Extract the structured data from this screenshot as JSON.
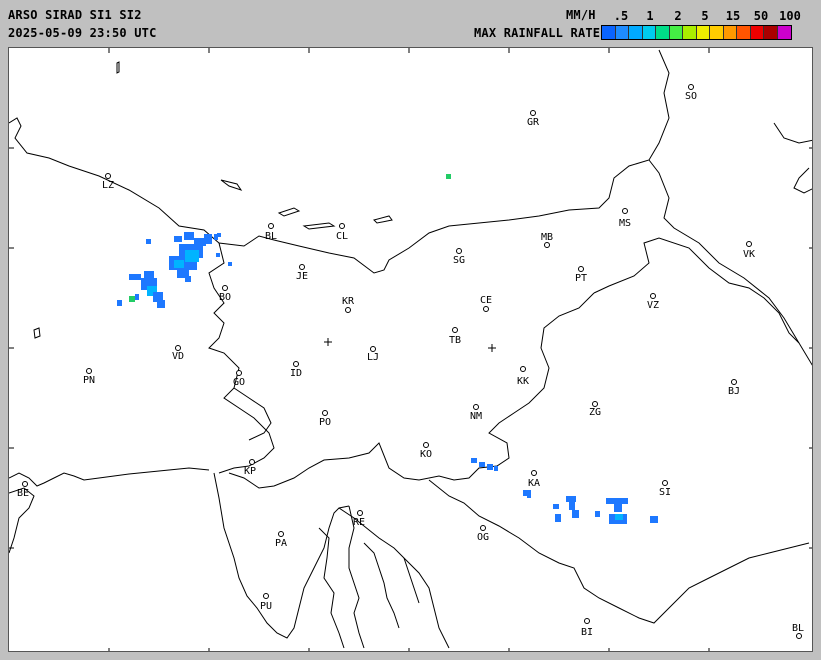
{
  "header": {
    "title": "ARSO SIRAD SI1 SI2",
    "timestamp": "2025-05-09 23:50 UTC",
    "unit": "MM/H",
    "legend_label": "MAX RAINFALL RATE"
  },
  "legend": {
    "ticks": [
      ".5",
      "1",
      "2",
      "5",
      "15",
      "50",
      "100"
    ],
    "colors": [
      "#0a64ff",
      "#1e8cff",
      "#00aaff",
      "#00ccee",
      "#00dd88",
      "#44ee44",
      "#aaee00",
      "#eeee00",
      "#ffcc00",
      "#ff9900",
      "#ff5500",
      "#ee0000",
      "#aa0000",
      "#cc00cc"
    ]
  },
  "map": {
    "background": "#ffffff",
    "outline_color": "#000000",
    "cities": [
      {
        "label": "SO"
      },
      {
        "label": "GR"
      },
      {
        "label": "LZ"
      },
      {
        "label": "MS"
      },
      {
        "label": "BL"
      },
      {
        "label": "CL"
      },
      {
        "label": "MB"
      },
      {
        "label": "VK"
      },
      {
        "label": "JE"
      },
      {
        "label": "SG"
      },
      {
        "label": "PT"
      },
      {
        "label": "BO"
      },
      {
        "label": "KR"
      },
      {
        "label": "CE"
      },
      {
        "label": "VZ"
      },
      {
        "label": "TB"
      },
      {
        "label": "VD"
      },
      {
        "label": "LJ"
      },
      {
        "label": "PN"
      },
      {
        "label": "GO"
      },
      {
        "label": "ID"
      },
      {
        "label": "KK"
      },
      {
        "label": "BJ"
      },
      {
        "label": "ZG"
      },
      {
        "label": "NM"
      },
      {
        "label": "PO"
      },
      {
        "label": "KO"
      },
      {
        "label": "KP"
      },
      {
        "label": "KA"
      },
      {
        "label": "SI"
      },
      {
        "label": "BE"
      },
      {
        "label": "RE"
      },
      {
        "label": "PA"
      },
      {
        "label": "OG"
      },
      {
        "label": "PU"
      },
      {
        "label": "BI"
      },
      {
        "label": "BL"
      }
    ],
    "radar_sites": [
      "radar-site-lisca",
      "radar-site-pasja-ravan"
    ],
    "precipitation_colors": {
      "light": "#1e78ff",
      "medium": "#00b4ff",
      "heavy": "#22cc66"
    }
  }
}
